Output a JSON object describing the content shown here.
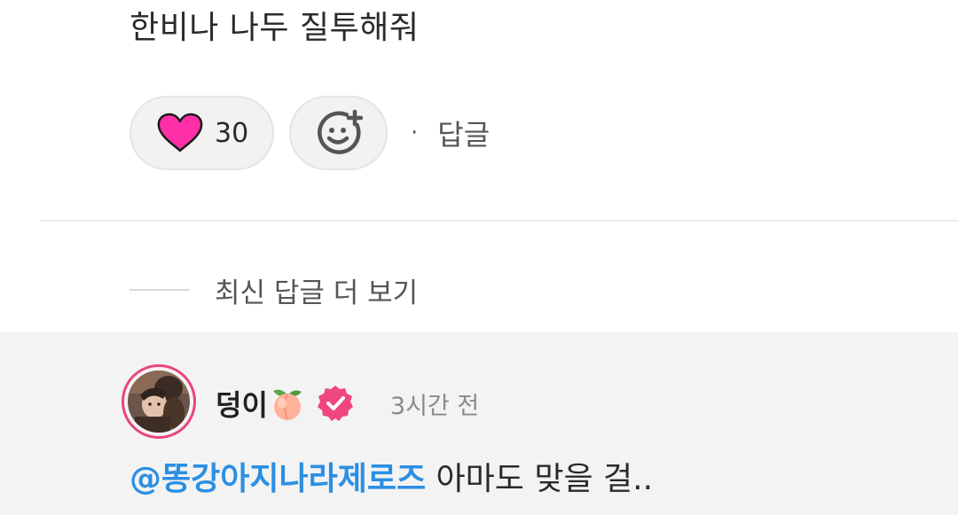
{
  "comment": {
    "text": "한비나 나두 질투해줘"
  },
  "reactions": {
    "like_icon": "heart-icon",
    "like_count": "30",
    "add_reaction_icon": "add-emoji-icon",
    "dot": "·",
    "reply_label": "답글"
  },
  "more_replies": {
    "label": "최신 답글 더 보기"
  },
  "reply": {
    "username": "덩이",
    "username_emoji": "peach-emoji",
    "verified_icon": "verified-badge-icon",
    "timestamp": "3시간 전",
    "mention": "@똥강아지나라제로즈",
    "text": " 아마도 맞을 걸.."
  },
  "colors": {
    "heart": "#ff2fa8",
    "verified": "#f0467f",
    "mention": "#2b8fe3",
    "avatar_ring": "#e8457e",
    "reply_background": "#f3f3f3"
  }
}
